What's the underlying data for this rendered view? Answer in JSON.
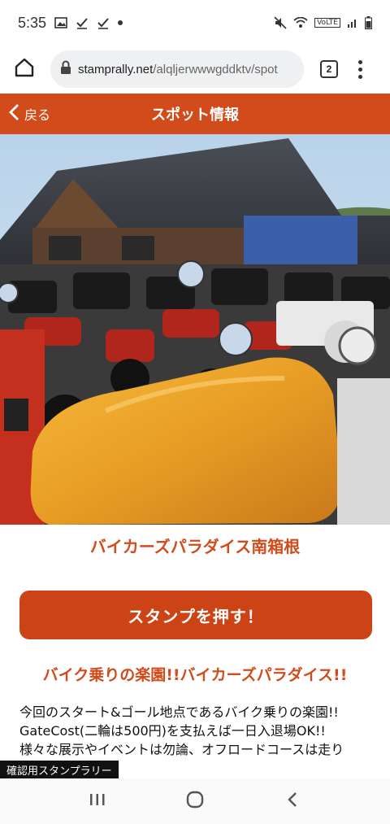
{
  "status_bar": {
    "time": "5:35",
    "battery_label": "VoLTE"
  },
  "browser": {
    "url_host": "stamprally.net",
    "url_path": "/alqljerwwwgddktv/spot",
    "tab_count": "2"
  },
  "header": {
    "back_label": "戻る",
    "title": "スポット情報"
  },
  "spot": {
    "name": "バイカーズパラダイス南箱根",
    "stamp_button": "スタンプを押す！",
    "catch": "バイク乗りの楽園!!バイカーズパラダイス!!",
    "description": [
      "今回のスタート&ゴール地点であるバイク乗りの楽園!!",
      "GateCost(二輪は500円)を支払えば一日入退場OK!!",
      "様々な展示やイベントは勿論、オフロードコースは走り"
    ]
  },
  "toast": "確認用スタンプラリー",
  "colors": {
    "accent": "#d24b1a",
    "button": "#cc4415"
  },
  "icons": [
    "home-icon",
    "lock-icon",
    "tabs-icon",
    "more-vert-icon",
    "back-chevron-icon",
    "recents-icon",
    "home-circle-icon",
    "back-arrow-icon"
  ]
}
